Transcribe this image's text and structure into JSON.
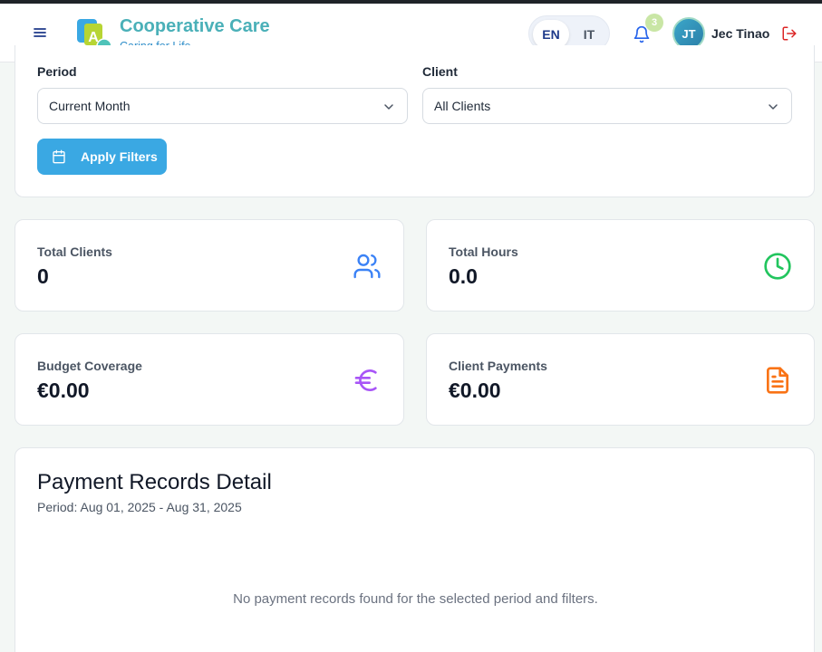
{
  "header": {
    "brand_name": "Cooperative Care",
    "brand_tagline": "Caring for Life",
    "languages": [
      "EN",
      "IT"
    ],
    "active_language": "EN",
    "notification_count": "3",
    "user_initials": "JT",
    "user_name": "Jec Tinao"
  },
  "filters": {
    "period_label": "Period",
    "period_value": "Current Month",
    "client_label": "Client",
    "client_value": "All Clients",
    "apply_label": "Apply Filters"
  },
  "stats": [
    {
      "title": "Total Clients",
      "value": "0",
      "icon": "users-icon",
      "color": "#3b82f6"
    },
    {
      "title": "Total Hours",
      "value": "0.0",
      "icon": "clock-icon",
      "color": "#22c55e"
    },
    {
      "title": "Budget Coverage",
      "value": "€0.00",
      "icon": "euro-icon",
      "color": "#a855f7"
    },
    {
      "title": "Client Payments",
      "value": "€0.00",
      "icon": "document-icon",
      "color": "#f97316"
    }
  ],
  "records": {
    "title": "Payment Records Detail",
    "period": "Period: Aug 01, 2025 - Aug 31, 2025",
    "empty_message": "No payment records found for the selected period and filters."
  },
  "colors": {
    "accent": "#3aa8e3",
    "brand_teal": "#4ab0b8",
    "logout_red": "#dc2626"
  }
}
